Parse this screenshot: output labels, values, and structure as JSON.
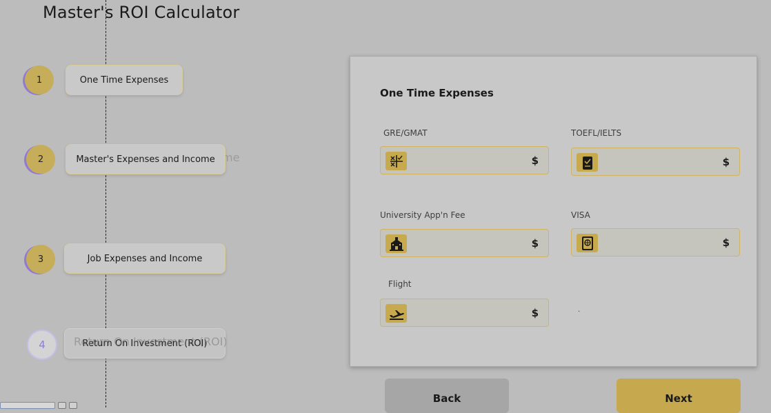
{
  "page": {
    "title": "Master's ROI Calculator"
  },
  "steps": [
    {
      "number": "1",
      "label": "One Time Expenses",
      "active": true
    },
    {
      "number": "2",
      "label": "Master's Expenses and Income",
      "active": true,
      "ghost_text": "me"
    },
    {
      "number": "3",
      "label": "Job Expenses and Income",
      "active": true
    },
    {
      "number": "4",
      "label": "Return On Investment (ROI)",
      "active": false,
      "ghost_text": "Return On Investment (ROI)"
    }
  ],
  "form": {
    "title": "One Time Expenses",
    "currency_symbol": "$",
    "fields": [
      {
        "label": "GRE/GMAT",
        "icon": "calculator-icon",
        "value": ""
      },
      {
        "label": "TOEFL/IELTS",
        "icon": "clipboard-check-icon",
        "value": ""
      },
      {
        "label": "University App'n Fee",
        "icon": "school-icon",
        "value": ""
      },
      {
        "label": "VISA",
        "icon": "passport-icon",
        "value": ""
      },
      {
        "label": "Flight",
        "icon": "airplane-takeoff-icon",
        "value": ""
      }
    ],
    "dot": "."
  },
  "buttons": {
    "back": "Back",
    "next": "Next"
  },
  "colors": {
    "accent": "#c6a94e",
    "accent_border": "#d0b460",
    "step_shadow": "#8f7ad6",
    "inactive_ring": "#c7bde9"
  }
}
